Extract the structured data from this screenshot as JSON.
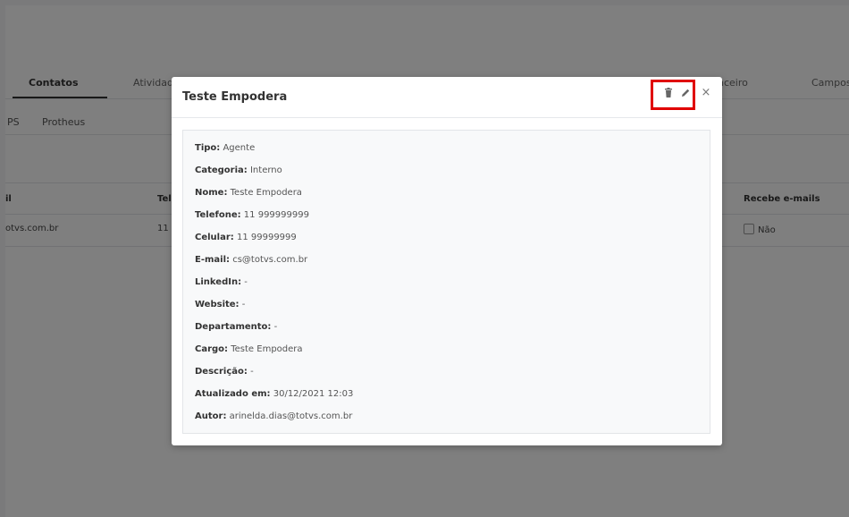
{
  "background": {
    "tabs": [
      {
        "label": "Contatos",
        "active": true
      },
      {
        "label": "Atividad"
      },
      {
        "label": "nceiro"
      },
      {
        "label": "Campos"
      }
    ],
    "subtabs": [
      "PS",
      "Protheus"
    ],
    "table": {
      "headers": [
        "il",
        "Tel",
        "Recebe e-mails"
      ],
      "row": {
        "email": "otvs.com.br",
        "phone": "11",
        "receives_emails": "Não"
      }
    }
  },
  "modal": {
    "title": "Teste Empodera",
    "actions": {
      "delete_icon": "trash-icon",
      "edit_icon": "pencil-icon",
      "close_glyph": "×"
    },
    "highlight_color": "#e00000",
    "fields": [
      {
        "label": "Tipo:",
        "value": "Agente"
      },
      {
        "label": "Categoria:",
        "value": "Interno"
      },
      {
        "label": "Nome:",
        "value": "Teste Empodera"
      },
      {
        "label": "Telefone:",
        "value": "11 999999999"
      },
      {
        "label": "Celular:",
        "value": "11 99999999"
      },
      {
        "label": "E-mail:",
        "value": "cs@totvs.com.br"
      },
      {
        "label": "LinkedIn:",
        "value": "-"
      },
      {
        "label": "Website:",
        "value": "-"
      },
      {
        "label": "Departamento:",
        "value": "-"
      },
      {
        "label": "Cargo:",
        "value": "Teste Empodera"
      },
      {
        "label": "Descrição:",
        "value": "-"
      },
      {
        "label": "Atualizado em:",
        "value": "30/12/2021 12:03"
      },
      {
        "label": "Autor:",
        "value": "arinelda.dias@totvs.com.br"
      }
    ]
  }
}
